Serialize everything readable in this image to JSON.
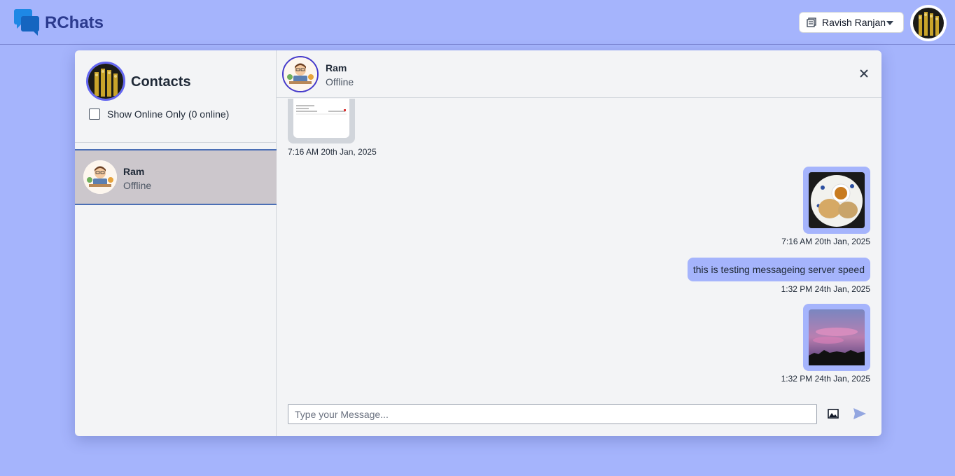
{
  "app": {
    "brand": "RChats"
  },
  "header": {
    "user_name": "Ravish Ranjan"
  },
  "sidebar": {
    "title": "Contacts",
    "online_toggle_label": "Show Online Only (0 online)",
    "contacts": [
      {
        "name": "Ram",
        "status": "Offline"
      }
    ]
  },
  "chat": {
    "contact_name": "Ram",
    "contact_status": "Offline",
    "messages": [
      {
        "type": "image",
        "direction": "received",
        "time": "7:16 AM 20th Jan, 2025"
      },
      {
        "type": "image",
        "direction": "sent",
        "time": "7:16 AM 20th Jan, 2025"
      },
      {
        "type": "text",
        "direction": "sent",
        "text": "this is testing messageing server speed",
        "time": "1:32 PM 24th Jan, 2025"
      },
      {
        "type": "image",
        "direction": "sent",
        "time": "1:32 PM 24th Jan, 2025"
      }
    ],
    "input": {
      "placeholder": "Type your Message...",
      "value": ""
    }
  },
  "colors": {
    "background": "#a5b4fc",
    "sent_bubble": "#a5b4fc",
    "brand": "#2b3a8e",
    "accent": "#6366f1"
  },
  "icons": [
    "chat-bubbles-logo-icon",
    "profile-card-icon",
    "chevron-down-icon",
    "close-icon",
    "image-icon",
    "send-icon"
  ]
}
